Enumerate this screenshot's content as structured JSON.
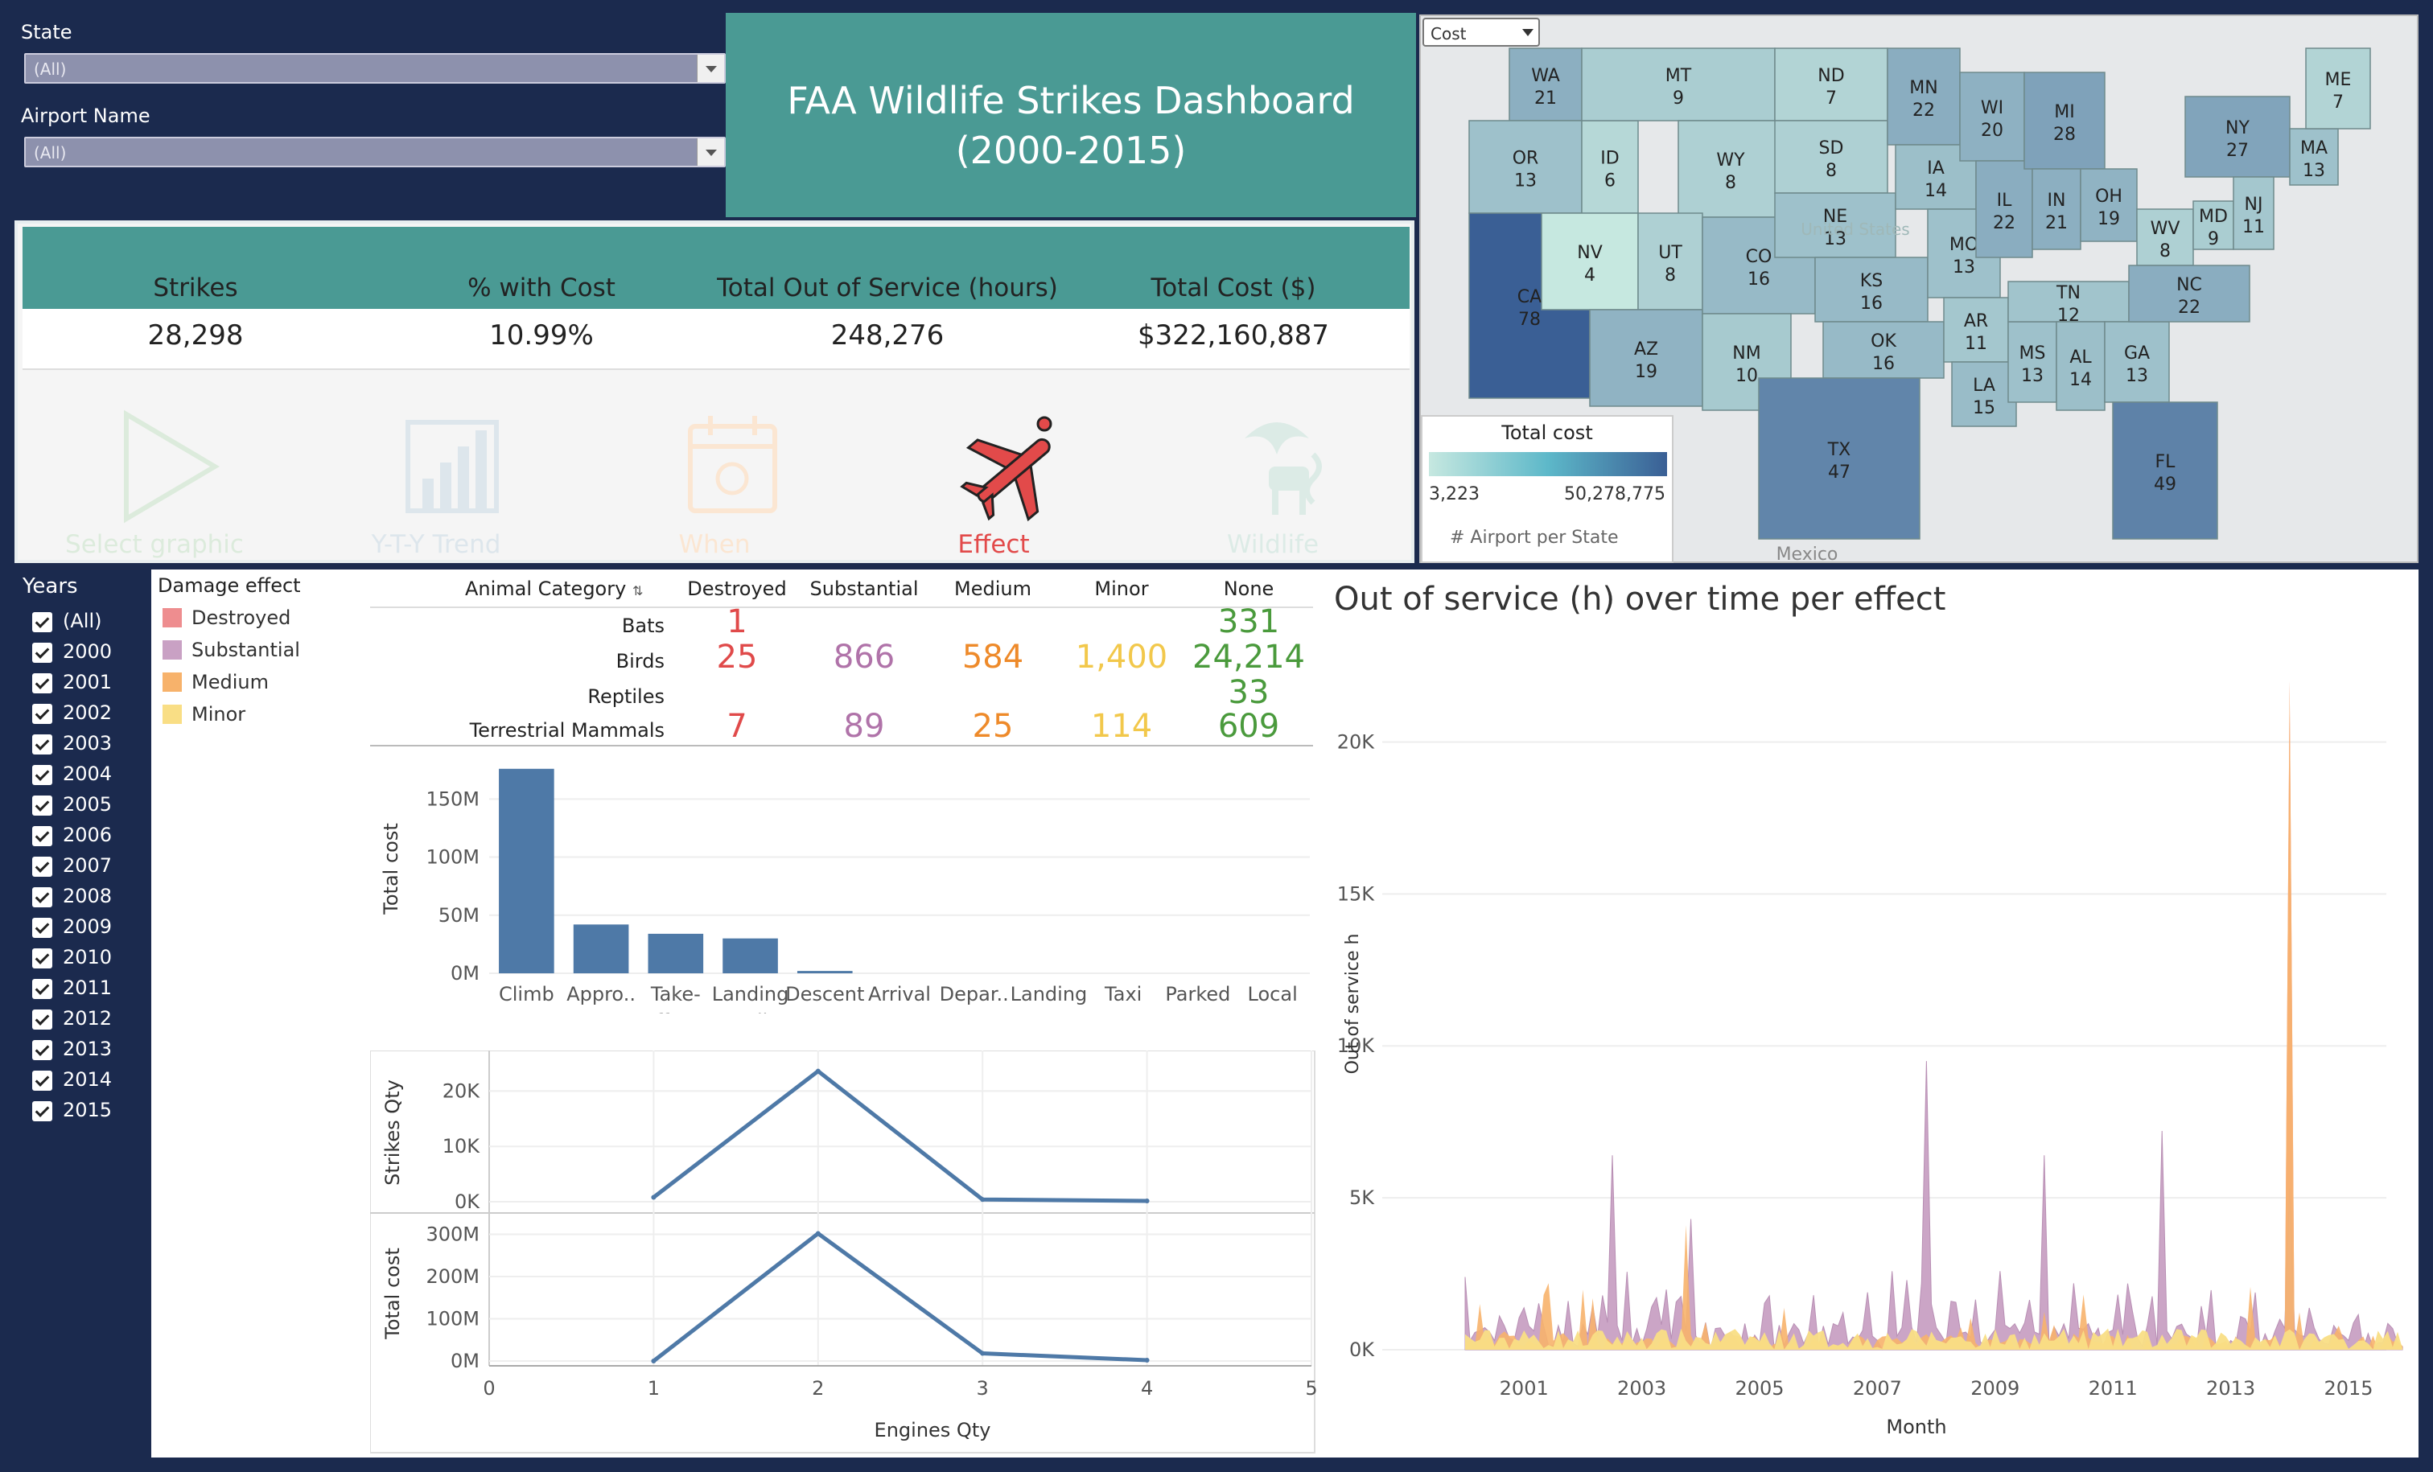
{
  "filters": {
    "state_label": "State",
    "state_value": "(All)",
    "airport_label": "Airport Name",
    "airport_value": "(All)"
  },
  "title": {
    "line1": "FAA Wildlife Strikes Dashboard",
    "line2": "(2000-2015)"
  },
  "kpis": [
    {
      "label": "Strikes",
      "value": "28,298"
    },
    {
      "label": "% with Cost",
      "value": "10.99%"
    },
    {
      "label": "Total Out of Service (hours)",
      "value": "248,276"
    },
    {
      "label": "Total Cost ($)",
      "value": "$322,160,887"
    }
  ],
  "nav": [
    {
      "label": "Select graphic",
      "icon": "play-triangle-icon",
      "color": "#dcebdc",
      "active": false
    },
    {
      "label": "Y-T-Y Trend",
      "icon": "bar-chart-icon",
      "color": "#dde6ec",
      "active": false
    },
    {
      "label": "When",
      "icon": "calendar-icon",
      "color": "#fbe6d2",
      "active": false
    },
    {
      "label": "Effect",
      "icon": "damaged-plane-icon",
      "color": "#e24a4a",
      "active": true
    },
    {
      "label": "Wildlife",
      "icon": "wildlife-icon",
      "color": "#dcebe6",
      "active": false
    }
  ],
  "map": {
    "dropdown_value": "Cost",
    "legend_title": "Total cost",
    "legend_min": "3,223",
    "legend_max": "50,278,775",
    "legend_footer": "# Airport per State",
    "watermark": "United States",
    "country_label": "Mexico",
    "color_low": "#c6e8e0",
    "color_high": "#3a5f95",
    "states": [
      {
        "code": "WA",
        "n": "21"
      },
      {
        "code": "OR",
        "n": "13"
      },
      {
        "code": "CA",
        "n": "78"
      },
      {
        "code": "ID",
        "n": "6"
      },
      {
        "code": "NV",
        "n": "4"
      },
      {
        "code": "MT",
        "n": "9"
      },
      {
        "code": "WY",
        "n": "8"
      },
      {
        "code": "UT",
        "n": "8"
      },
      {
        "code": "AZ",
        "n": "19"
      },
      {
        "code": "CO",
        "n": "16"
      },
      {
        "code": "NM",
        "n": "10"
      },
      {
        "code": "ND",
        "n": "7"
      },
      {
        "code": "SD",
        "n": "8"
      },
      {
        "code": "NE",
        "n": "13"
      },
      {
        "code": "KS",
        "n": "16"
      },
      {
        "code": "OK",
        "n": "16"
      },
      {
        "code": "TX",
        "n": "47"
      },
      {
        "code": "MN",
        "n": "22"
      },
      {
        "code": "IA",
        "n": "14"
      },
      {
        "code": "MO",
        "n": "13"
      },
      {
        "code": "AR",
        "n": "11"
      },
      {
        "code": "LA",
        "n": "15"
      },
      {
        "code": "WI",
        "n": "20"
      },
      {
        "code": "IL",
        "n": "22"
      },
      {
        "code": "MS",
        "n": "13"
      },
      {
        "code": "MI",
        "n": "28"
      },
      {
        "code": "IN",
        "n": "21"
      },
      {
        "code": "TN",
        "n": "12"
      },
      {
        "code": "AL",
        "n": "14"
      },
      {
        "code": "OH",
        "n": "19"
      },
      {
        "code": "GA",
        "n": "13"
      },
      {
        "code": "FL",
        "n": "49"
      },
      {
        "code": "WV",
        "n": "8"
      },
      {
        "code": "NC",
        "n": "22"
      },
      {
        "code": "MD",
        "n": "9"
      },
      {
        "code": "NY",
        "n": "27"
      },
      {
        "code": "NJ",
        "n": "11"
      },
      {
        "code": "MA",
        "n": "13"
      },
      {
        "code": "ME",
        "n": "7"
      }
    ]
  },
  "years": {
    "title": "Years",
    "items": [
      "(All)",
      "2000",
      "2001",
      "2002",
      "2003",
      "2004",
      "2005",
      "2006",
      "2007",
      "2008",
      "2009",
      "2010",
      "2011",
      "2012",
      "2013",
      "2014",
      "2015"
    ]
  },
  "damage_legend": {
    "title": "Damage effect",
    "items": [
      {
        "label": "Destroyed",
        "color": "#ee8d8f"
      },
      {
        "label": "Substantial",
        "color": "#c9a1c4"
      },
      {
        "label": "Medium",
        "color": "#f7b26b"
      },
      {
        "label": "Minor",
        "color": "#f9de85"
      }
    ]
  },
  "table": {
    "row_header": "Animal Category",
    "columns": [
      "Destroyed",
      "Substantial",
      "Medium",
      "Minor",
      "None"
    ],
    "column_colors": [
      "#e04a4a",
      "#b073a9",
      "#ee8a2a",
      "#f2c84b",
      "#4a9a3c"
    ],
    "rows": [
      {
        "label": "Bats",
        "values": [
          "1",
          "",
          "",
          "",
          "331"
        ]
      },
      {
        "label": "Birds",
        "values": [
          "25",
          "866",
          "584",
          "1,400",
          "24,214"
        ]
      },
      {
        "label": "Reptiles",
        "values": [
          "",
          "",
          "",
          "",
          "33"
        ]
      },
      {
        "label": "Terrestrial Mammals",
        "values": [
          "7",
          "89",
          "25",
          "114",
          "609"
        ]
      }
    ]
  },
  "chart_data": [
    {
      "type": "bar",
      "ylabel": "Total cost",
      "categories": [
        "Climb",
        "Appro..",
        "Take-off run",
        "Landing Roll",
        "Descent",
        "Arrival",
        "Depar..",
        "Landing",
        "Taxi",
        "Parked",
        "Local"
      ],
      "values": [
        176000000,
        42000000,
        34000000,
        30000000,
        2000000,
        0,
        0,
        0,
        0,
        0,
        0
      ],
      "yticks": [
        "0M",
        "50M",
        "100M",
        "150M"
      ],
      "ylim": [
        0,
        180000000
      ],
      "color": "#4e79a7"
    },
    {
      "type": "line",
      "ylabel": "Strikes Qty",
      "x": [
        1,
        2,
        3,
        4
      ],
      "values": [
        800,
        23600,
        400,
        150
      ],
      "yticks": [
        "0K",
        "10K",
        "20K"
      ],
      "ylim": [
        0,
        25000
      ],
      "color": "#4e79a7"
    },
    {
      "type": "line",
      "ylabel": "Total cost",
      "xlabel": "Engines Qty",
      "x": [
        1,
        2,
        3,
        4
      ],
      "values": [
        0,
        302000000,
        18000000,
        2000000
      ],
      "yticks": [
        "0M",
        "100M",
        "200M",
        "300M"
      ],
      "xticks": [
        "0",
        "1",
        "2",
        "3",
        "4",
        "5"
      ],
      "ylim": [
        0,
        320000000
      ],
      "color": "#4e79a7"
    },
    {
      "type": "area",
      "title": "Out of service (h) over time per effect",
      "xlabel": "Month",
      "ylabel": "Out of service h",
      "xticks": [
        "2001",
        "2003",
        "2005",
        "2007",
        "2009",
        "2011",
        "2013",
        "2015"
      ],
      "yticks": [
        "0K",
        "5K",
        "10K",
        "15K",
        "20K"
      ],
      "ylim": [
        0,
        22500
      ],
      "series_colors": [
        "#c9a1c4",
        "#f7b26b",
        "#f9de85",
        "#ee8d8f"
      ]
    }
  ]
}
